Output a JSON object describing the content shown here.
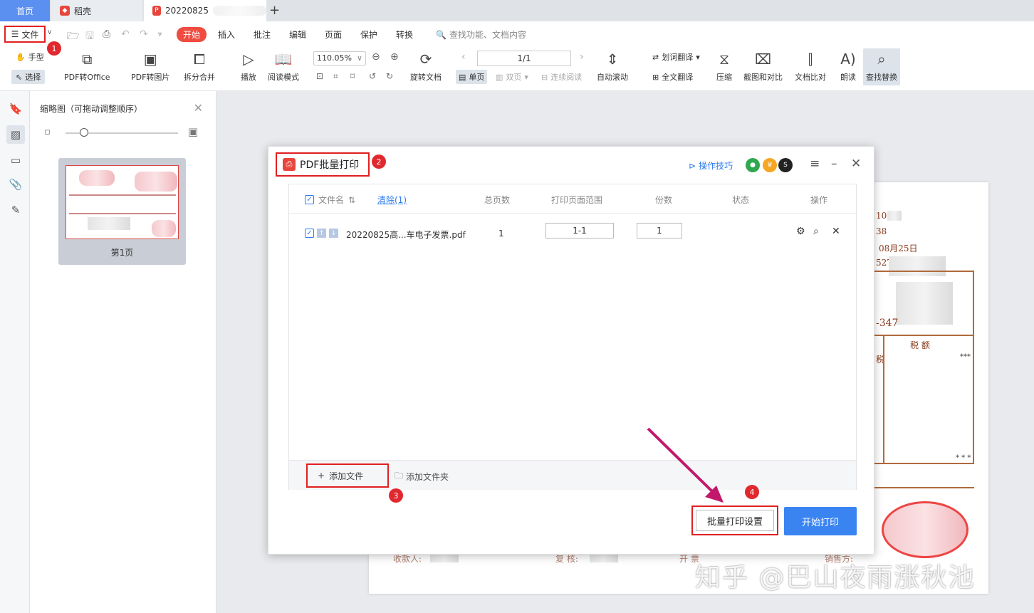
{
  "tabs": {
    "home": "首页",
    "docer": "稻壳",
    "pdf_doc": "20220825"
  },
  "menu": {
    "file": "文件",
    "tabs": [
      "开始",
      "插入",
      "批注",
      "编辑",
      "页面",
      "保护",
      "转换"
    ],
    "search_placeholder": "查找功能、文档内容"
  },
  "toolbar": {
    "hand": "手型",
    "select": "选择",
    "pdf_to_office": "PDF转Office",
    "pdf_to_image": "PDF转图片",
    "split_merge": "拆分合并",
    "play": "播放",
    "read_mode": "阅读模式",
    "zoom": "110.05%",
    "rotate_doc": "旋转文档",
    "page_number": "1/1",
    "single_page": "单页",
    "double_page": "双页",
    "continuous": "连续阅读",
    "auto_scroll": "自动滚动",
    "word_translate": "划词翻译",
    "full_translate": "全文翻译",
    "compress": "压缩",
    "screenshot_compare": "截图和对比",
    "doc_compare": "文档比对",
    "read_aloud": "朗读",
    "find_replace": "查找替换"
  },
  "thumbnail_panel": {
    "title": "缩略图（可拖动调整顺序）",
    "page_label": "第1页"
  },
  "dialog": {
    "title": "PDF批量打印",
    "tips": "操作技巧",
    "columns": {
      "filename": "文件名",
      "clear": "清除(1)",
      "total_pages": "总页数",
      "print_range": "打印页面范围",
      "copies": "份数",
      "status": "状态",
      "actions": "操作"
    },
    "rows": [
      {
        "filename": "20220825高...车电子发票.pdf",
        "total_pages": "1",
        "print_range": "1-1",
        "copies": "1",
        "status": ""
      }
    ],
    "add_file": "添加文件",
    "add_folder": "添加文件夹",
    "batch_settings": "批量打印设置",
    "start_print": "开始打印"
  },
  "document": {
    "date_fragment": "08月25日",
    "tax_label": "税 额",
    "stars": "***",
    "stars2": "* * *",
    "payee": "收款人:",
    "reviewer": "复 核:",
    "issuer": "开 票",
    "seller": "销售方:",
    "frag1": "10",
    "frag2": "38",
    "frag3": "527",
    "frag4": "-347",
    "frag5": "税"
  },
  "steps": [
    "1",
    "2",
    "3",
    "4"
  ],
  "watermark": "知乎 @巴山夜雨涨秋池",
  "colors": {
    "accent_red": "#e02020",
    "primary_blue": "#3a84f2",
    "arrow_magenta": "#c2186b"
  }
}
